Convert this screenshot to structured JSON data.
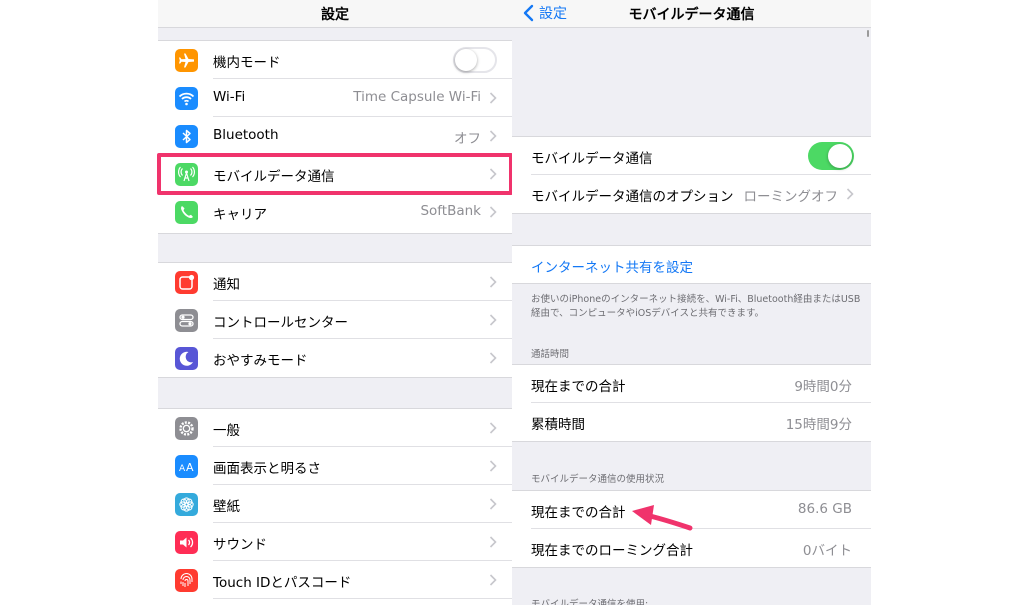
{
  "left": {
    "title": "設定",
    "group1": [
      {
        "label": "機内モード",
        "icon": "airplane-icon",
        "color": "#ff9500",
        "value": "",
        "toggle": "off"
      },
      {
        "label": "Wi-Fi",
        "icon": "wifi-icon",
        "color": "#1a8cff",
        "value": "Time Capsule Wi-Fi"
      },
      {
        "label": "Bluetooth",
        "icon": "bluetooth-icon",
        "color": "#1a8cff",
        "value": "オフ"
      },
      {
        "label": "モバイルデータ通信",
        "icon": "cellular-icon",
        "color": "#4cd964",
        "value": ""
      },
      {
        "label": "キャリア",
        "icon": "phone-icon",
        "color": "#4cd964",
        "value": "SoftBank"
      }
    ],
    "group2": [
      {
        "label": "通知",
        "icon": "notifications-icon",
        "color": "#ff3b30"
      },
      {
        "label": "コントロールセンター",
        "icon": "control-center-icon",
        "color": "#8e8e93"
      },
      {
        "label": "おやすみモード",
        "icon": "moon-icon",
        "color": "#5856d6"
      }
    ],
    "group3": [
      {
        "label": "一般",
        "icon": "gear-icon",
        "color": "#8e8e93"
      },
      {
        "label": "画面表示と明るさ",
        "icon": "display-aa-icon",
        "color": "#1a8cff"
      },
      {
        "label": "壁紙",
        "icon": "wallpaper-flower-icon",
        "color": "#34aadc"
      },
      {
        "label": "サウンド",
        "icon": "speaker-icon",
        "color": "#ff2d55"
      },
      {
        "label": "Touch IDとパスコード",
        "icon": "fingerprint-icon",
        "color": "#ff3b30"
      }
    ]
  },
  "right": {
    "back_label": "設定",
    "title": "モバイルデータ通信",
    "cellular_toggle_label": "モバイルデータ通信",
    "cellular_toggle_state": "on",
    "options_label": "モバイルデータ通信のオプション",
    "options_value": "ローミングオフ",
    "hotspot_link": "インターネット共有を設定",
    "hotspot_note": "お使いのiPhoneのインターネット接続を、Wi-Fi、Bluetooth経由またはUSB経由で、コンピュータやiOSデバイスと共有できます。",
    "call_time_header": "通話時間",
    "call_time_rows": [
      {
        "label": "現在までの合計",
        "value": "9時間0分"
      },
      {
        "label": "累積時間",
        "value": "15時間9分"
      }
    ],
    "usage_header": "モバイルデータ通信の使用状況",
    "usage_rows": [
      {
        "label": "現在までの合計",
        "value": "86.6 GB"
      },
      {
        "label": "現在までのローミング合計",
        "value": "0バイト"
      }
    ],
    "bottom_header_partial": "モバイルデータ通信を使用:"
  },
  "colors": {
    "highlight": "#f0336c",
    "accent_blue": "#1478f5",
    "toggle_green": "#4cd964"
  }
}
